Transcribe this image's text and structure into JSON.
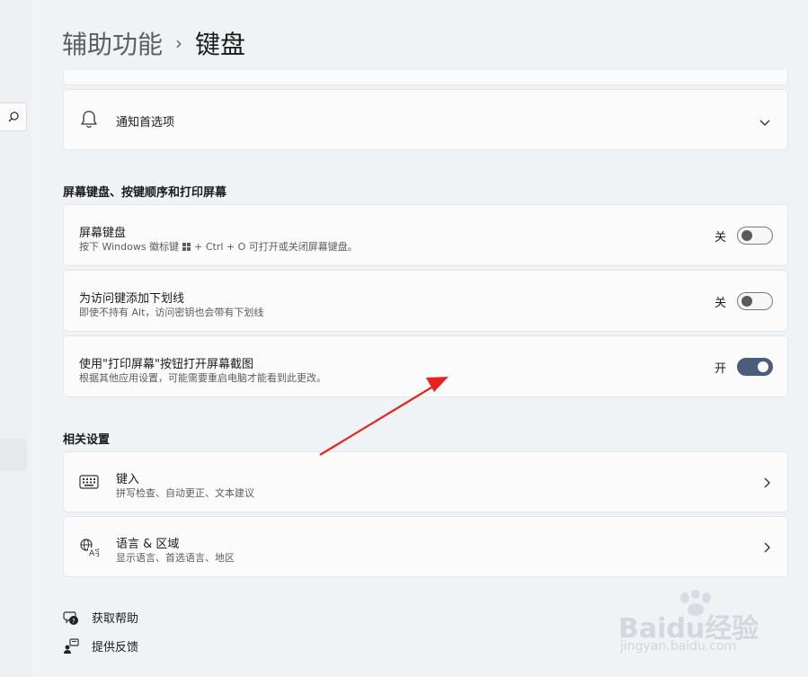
{
  "breadcrumb": {
    "parent": "辅助功能",
    "separator": "›",
    "current": "键盘"
  },
  "notification_row": {
    "title": "通知首选项",
    "icon": "bell-icon"
  },
  "section_keyboard": {
    "title": "屏幕键盘、按键顺序和打印屏幕",
    "rows": [
      {
        "title": "屏幕键盘",
        "subtitle_before": "按下 Windows 徽标键",
        "subtitle_after": "+ Ctrl + O 可打开或关闭屏幕键盘。",
        "state_label": "关",
        "on": false
      },
      {
        "title": "为访问键添加下划线",
        "subtitle": "即使不持有 Alt，访问密钥也会带有下划线",
        "state_label": "关",
        "on": false
      },
      {
        "title": "使用\"打印屏幕\"按钮打开屏幕截图",
        "subtitle": "根据其他应用设置，可能需要重启电脑才能看到此更改。",
        "state_label": "开",
        "on": true
      }
    ]
  },
  "section_related": {
    "title": "相关设置",
    "rows": [
      {
        "title": "键入",
        "subtitle": "拼写检查、自动更正、文本建议",
        "icon": "keyboard-icon"
      },
      {
        "title": "语言 & 区域",
        "subtitle": "显示语言、首选语言、地区",
        "icon": "language-icon"
      }
    ]
  },
  "footer": {
    "help": "获取帮助",
    "feedback": "提供反馈"
  },
  "watermark": {
    "brand_text": "Baidu经验",
    "url_text": "jingyan.baidu.com"
  },
  "colors": {
    "toggle_on": "#4a5e7c",
    "annotation_arrow": "#e8231f"
  }
}
